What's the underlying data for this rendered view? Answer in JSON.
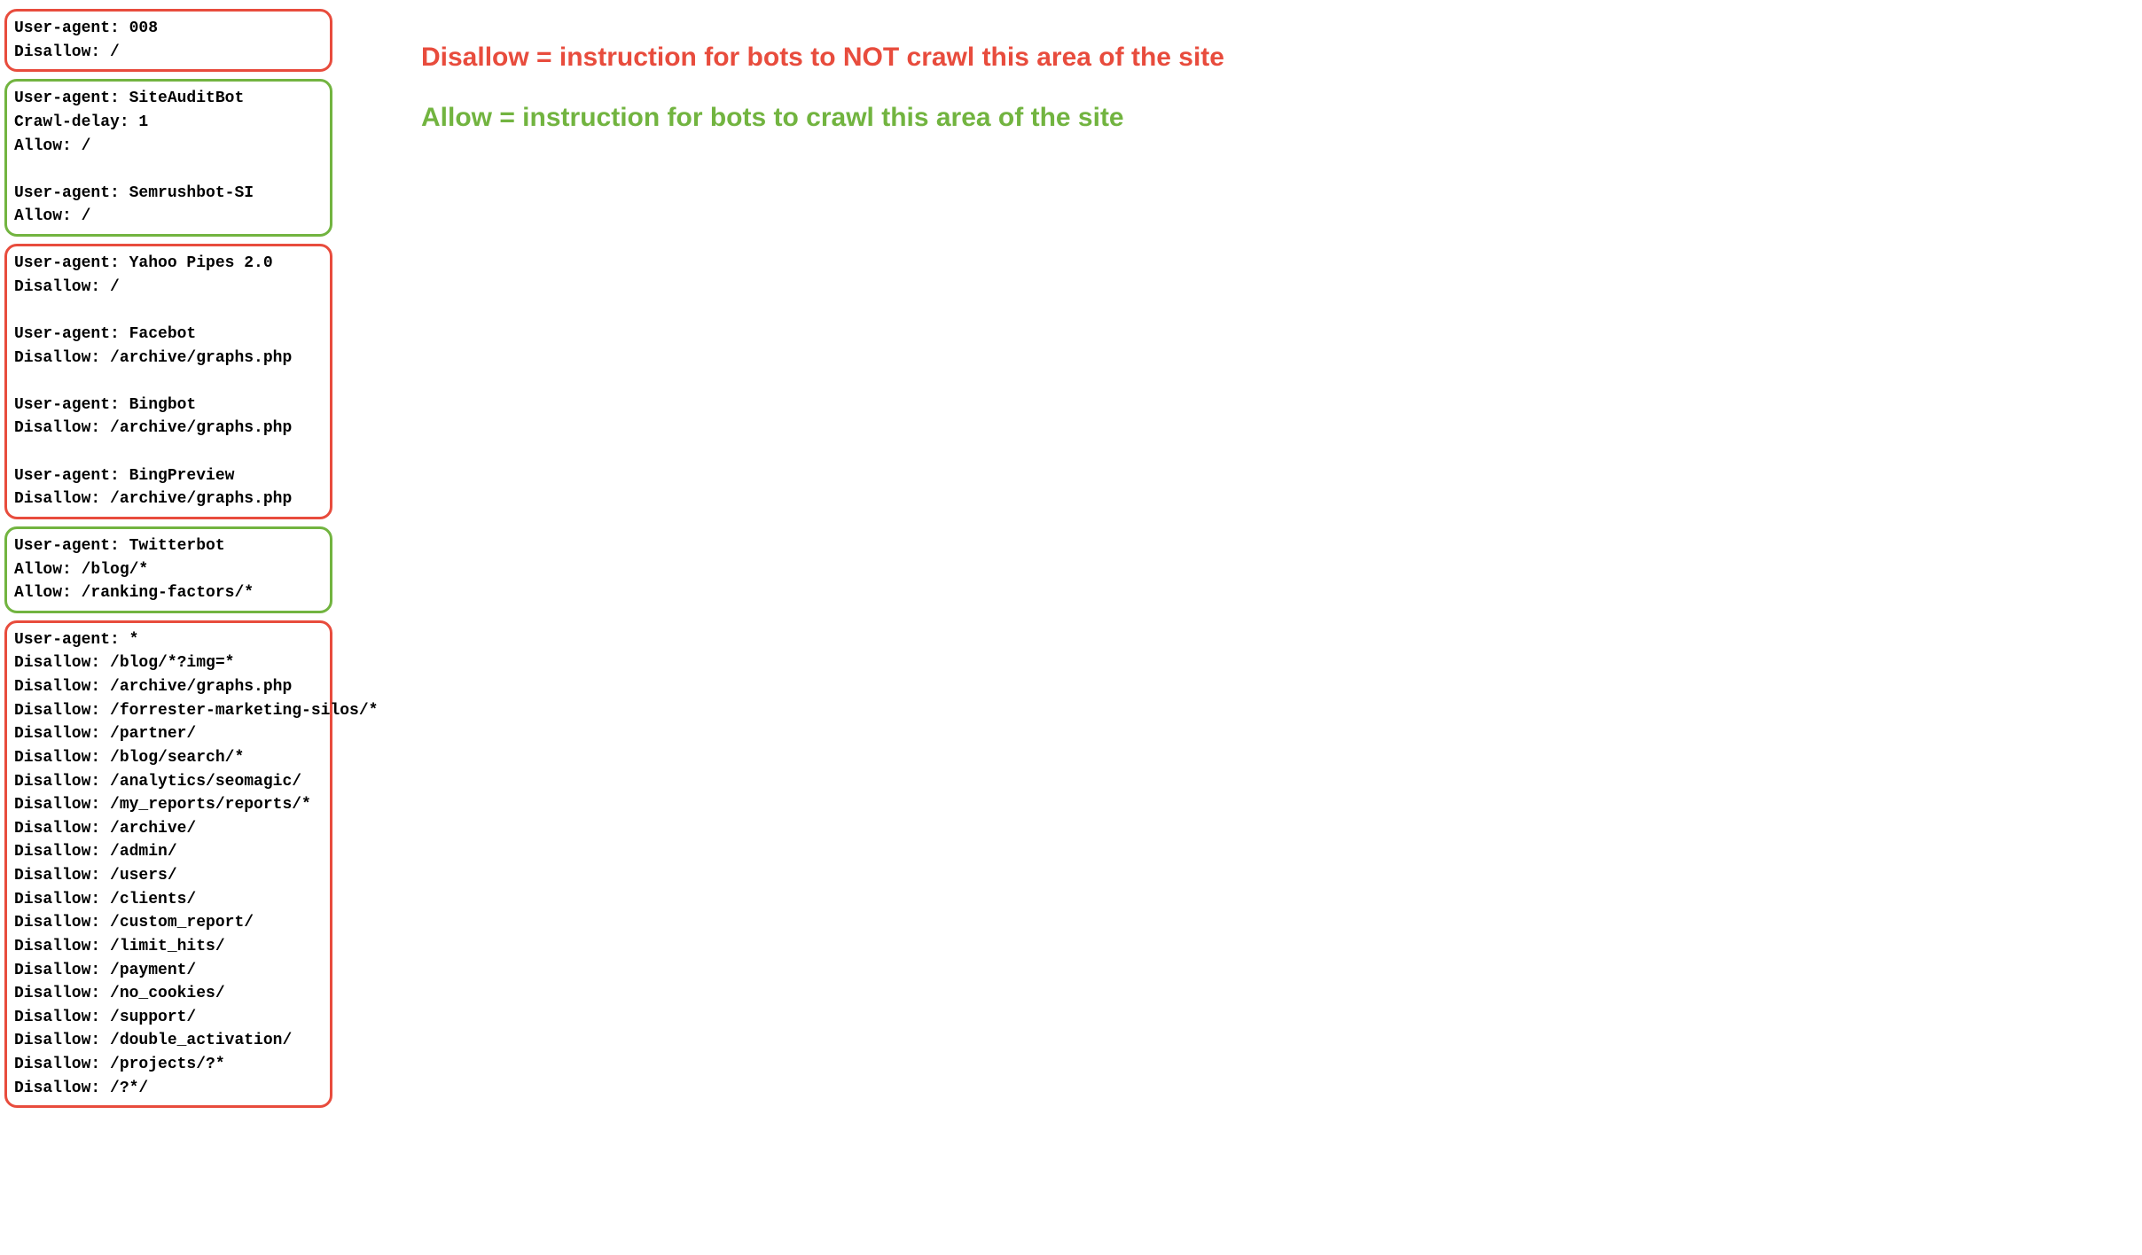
{
  "boxes": [
    {
      "color": "red",
      "text": "User-agent: 008\nDisallow: /"
    },
    {
      "color": "green",
      "text": "User-agent: SiteAuditBot\nCrawl-delay: 1\nAllow: /\n\nUser-agent: Semrushbot-SI\nAllow: /"
    },
    {
      "color": "red",
      "text": "User-agent: Yahoo Pipes 2.0\nDisallow: /\n\nUser-agent: Facebot\nDisallow: /archive/graphs.php\n\nUser-agent: Bingbot\nDisallow: /archive/graphs.php\n\nUser-agent: BingPreview\nDisallow: /archive/graphs.php"
    },
    {
      "color": "green",
      "text": "User-agent: Twitterbot\nAllow: /blog/*\nAllow: /ranking-factors/*"
    },
    {
      "color": "red",
      "text": "User-agent: *\nDisallow: /blog/*?img=*\nDisallow: /archive/graphs.php\nDisallow: /forrester-marketing-silos/*\nDisallow: /partner/\nDisallow: /blog/search/*\nDisallow: /analytics/seomagic/\nDisallow: /my_reports/reports/*\nDisallow: /archive/\nDisallow: /admin/\nDisallow: /users/\nDisallow: /clients/\nDisallow: /custom_report/\nDisallow: /limit_hits/\nDisallow: /payment/\nDisallow: /no_cookies/\nDisallow: /support/\nDisallow: /double_activation/\nDisallow: /projects/?*\nDisallow: /?*/"
    }
  ],
  "legend": {
    "disallow": "Disallow = instruction for bots to NOT crawl this area of the site",
    "allow": "Allow = instruction for bots to crawl this area of the site"
  }
}
